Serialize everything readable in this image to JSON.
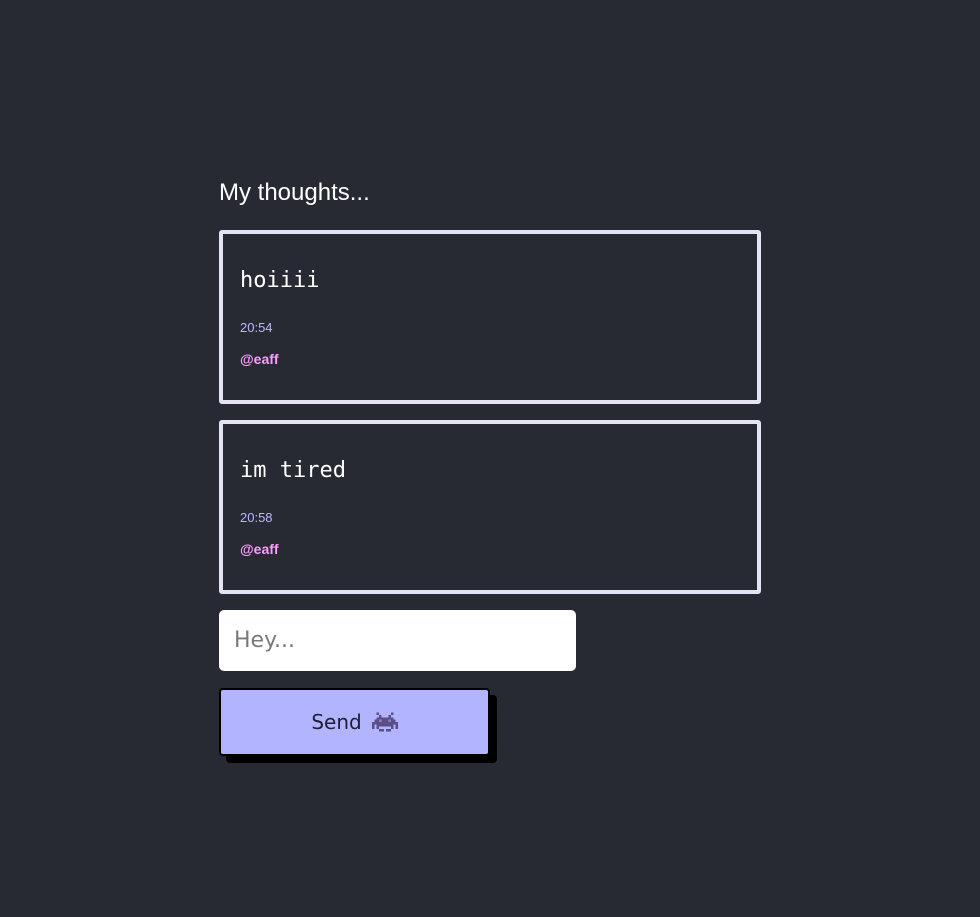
{
  "page": {
    "title": "My thoughts..."
  },
  "thoughts": [
    {
      "text": "hoiiii",
      "time": "20:54",
      "author": "@eaff"
    },
    {
      "text": "im tired",
      "time": "20:58",
      "author": "@eaff"
    }
  ],
  "composer": {
    "placeholder": "Hey...",
    "value": "",
    "send_label": "Send",
    "send_icon": "alien-monster-icon"
  },
  "colors": {
    "background": "#272a33",
    "card_border": "#e3e3f3",
    "time": "#b9b9ff",
    "author": "#ff9cff",
    "button": "#b2b4ff"
  }
}
